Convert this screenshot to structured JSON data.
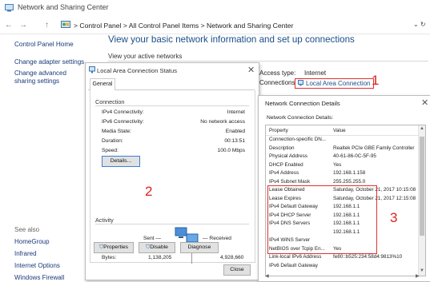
{
  "window": {
    "title": "Network and Sharing Center"
  },
  "address": {
    "back": "←",
    "forward": "→",
    "up": "↑",
    "crumbs": "> Control Panel > All Control Panel Items > Network and Sharing Center",
    "dropdown": "⌄ ↻"
  },
  "sidebar": {
    "home": "Control Panel Home",
    "links": [
      "Change adapter settings",
      "Change advanced sharing settings"
    ],
    "see_also_title": "See also",
    "see_also": [
      "HomeGroup",
      "Infrared",
      "Internet Options",
      "Windows Firewall"
    ]
  },
  "main": {
    "title": "View your basic network information and set up connections",
    "subtitle": "View your active networks",
    "access_type_label": "Access type:",
    "access_type_value": "Internet",
    "connections_label": "Connections:",
    "connection_name": "Local Area Connection"
  },
  "annotations": {
    "one": "1",
    "two": "2",
    "three": "3"
  },
  "status_dialog": {
    "title": "Local Area Connection Status",
    "close": "✕",
    "tab": "General",
    "connection_group": "Connection",
    "rows": [
      {
        "label": "IPv4 Connectivity:",
        "value": "Internet"
      },
      {
        "label": "IPv6 Connectivity:",
        "value": "No network access"
      },
      {
        "label": "Media State:",
        "value": "Enabled"
      },
      {
        "label": "Duration:",
        "value": "00:13:51"
      },
      {
        "label": "Speed:",
        "value": "100.0 Mbps"
      }
    ],
    "details_button": "Details...",
    "activity_group": "Activity",
    "sent_label": "Sent —",
    "received_label": "— Received",
    "bytes_label": "Bytes:",
    "bytes_sent": "1,138,205",
    "bytes_received": "4,928,660",
    "properties_button": "Properties",
    "disable_button": "Disable",
    "diagnose_button": "Diagnose",
    "close_button": "Close"
  },
  "details_dialog": {
    "title": "Network Connection Details",
    "close": "✕",
    "label": "Network Connection Details:",
    "col_property": "Property",
    "col_value": "Value",
    "rows": [
      {
        "p": "Connection-specific DN...",
        "v": ""
      },
      {
        "p": "Description",
        "v": "Realtek PCIe GBE Family Controller"
      },
      {
        "p": "Physical Address",
        "v": "40-61-86-0C-5F-95"
      },
      {
        "p": "DHCP Enabled",
        "v": "Yes"
      },
      {
        "p": "IPv4 Address",
        "v": "192.168.1.158"
      },
      {
        "p": "IPv4 Subnet Mask",
        "v": "255.255.255.0"
      },
      {
        "p": "Lease Obtained",
        "v": "Saturday, October 21, 2017 10:15:08"
      },
      {
        "p": "Lease Expires",
        "v": "Saturday, October 21, 2017 12:15:08"
      },
      {
        "p": "IPv4 Default Gateway",
        "v": "192.168.1.1"
      },
      {
        "p": "IPv4 DHCP Server",
        "v": "192.168.1.1"
      },
      {
        "p": "IPv4 DNS Servers",
        "v": "192.168.1.1"
      },
      {
        "p": "",
        "v": "192.168.1.1"
      },
      {
        "p": "IPv4 WINS Server",
        "v": ""
      },
      {
        "p": "NetBIOS over Tcpip En...",
        "v": "Yes"
      },
      {
        "p": "Link-local IPv6 Address",
        "v": "fe80::b525:234:58d4:9813%10"
      },
      {
        "p": "IPv6 Default Gateway",
        "v": ""
      }
    ]
  },
  "colors": {
    "annotation": "#e02020",
    "link": "#1a4e8a",
    "title": "#1a4e8a"
  }
}
